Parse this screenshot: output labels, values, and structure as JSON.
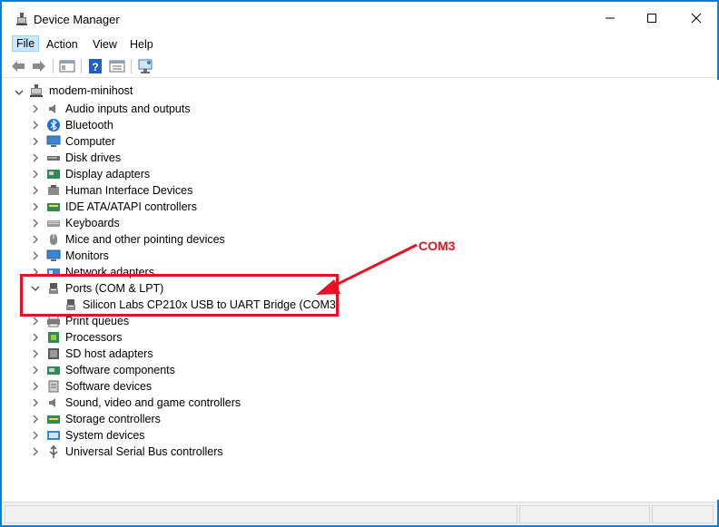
{
  "window": {
    "title": "Device Manager"
  },
  "menu": {
    "file": "File",
    "action": "Action",
    "view": "View",
    "help": "Help"
  },
  "tree": {
    "root": "modem-minihost",
    "categories": [
      {
        "label": "Audio inputs and outputs",
        "icon": "speaker-icon"
      },
      {
        "label": "Bluetooth",
        "icon": "bluetooth-icon"
      },
      {
        "label": "Computer",
        "icon": "computer-icon"
      },
      {
        "label": "Disk drives",
        "icon": "disk-drive-icon"
      },
      {
        "label": "Display adapters",
        "icon": "display-adapter-icon"
      },
      {
        "label": "Human Interface Devices",
        "icon": "hid-icon"
      },
      {
        "label": "IDE ATA/ATAPI controllers",
        "icon": "ide-controller-icon"
      },
      {
        "label": "Keyboards",
        "icon": "keyboard-icon"
      },
      {
        "label": "Mice and other pointing devices",
        "icon": "mouse-icon"
      },
      {
        "label": "Monitors",
        "icon": "monitor-icon"
      },
      {
        "label": "Network adapters",
        "icon": "network-adapter-icon"
      },
      {
        "label": "Ports (COM & LPT)",
        "icon": "port-icon",
        "expanded": true
      },
      {
        "label": "Print queues",
        "icon": "printer-icon"
      },
      {
        "label": "Processors",
        "icon": "processor-icon"
      },
      {
        "label": "SD host adapters",
        "icon": "sd-adapter-icon"
      },
      {
        "label": "Software components",
        "icon": "software-component-icon"
      },
      {
        "label": "Software devices",
        "icon": "software-device-icon"
      },
      {
        "label": "Sound, video and game controllers",
        "icon": "sound-controller-icon"
      },
      {
        "label": "Storage controllers",
        "icon": "storage-controller-icon"
      },
      {
        "label": "System devices",
        "icon": "system-device-icon"
      },
      {
        "label": "Universal Serial Bus controllers",
        "icon": "usb-icon"
      }
    ],
    "port_child": "Silicon Labs CP210x USB to UART Bridge (COM3)"
  },
  "annotation": {
    "label": "COM3",
    "color": "#e81123"
  }
}
